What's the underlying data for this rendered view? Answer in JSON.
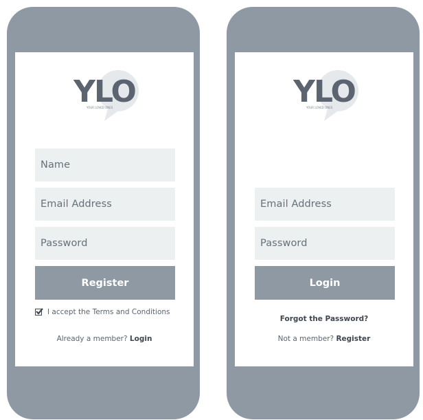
{
  "register_screen": {
    "logo": {
      "wordmark": "YLO",
      "tagline": "YOUR LOVED ONES"
    },
    "name_placeholder": "Name",
    "email_placeholder": "Email Address",
    "password_placeholder": "Password",
    "register_button": "Register",
    "terms_label": "I accept the Terms and Conditions",
    "terms_checked": true,
    "already_member_text": "Already a member?",
    "login_link": "Login"
  },
  "login_screen": {
    "logo": {
      "wordmark": "YLO",
      "tagline": "YOUR LOVED ONES"
    },
    "email_placeholder": "Email Address",
    "password_placeholder": "Password",
    "login_button": "Login",
    "forgot_password_link": "Forgot the Password?",
    "not_member_text": "Not a member?",
    "register_link": "Register"
  },
  "colors": {
    "frame": "#8f99a4",
    "field_bg": "#ecf0f1",
    "button_bg": "#8f99a4",
    "text": "#5b6470",
    "text_strong": "#3f4650"
  }
}
